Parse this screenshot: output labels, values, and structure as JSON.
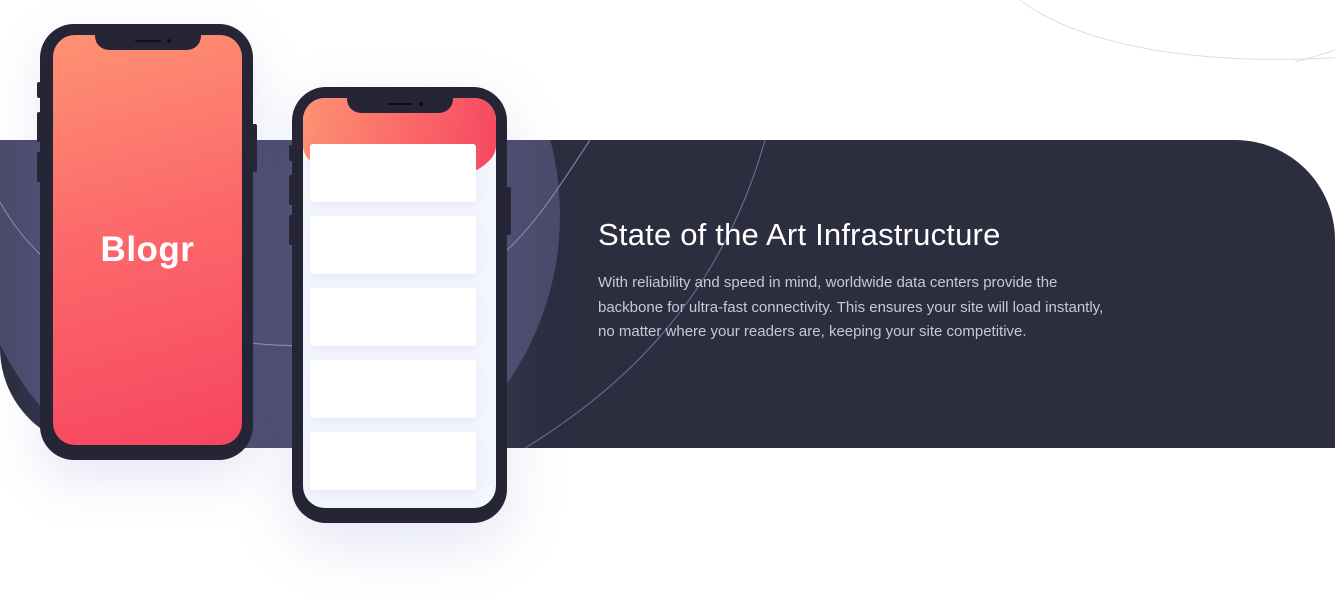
{
  "hero": {
    "heading": "State of the Art Infrastructure",
    "body": "With reliability and speed in mind, worldwide data centers provide the backbone for ultra-fast connectivity. This ensures your site will load instantly, no matter where your readers are, keeping your site competitive."
  },
  "phone_mockup": {
    "logo_text": "Blogr",
    "card_count": 5
  },
  "colors": {
    "band_background": "#2c2d3f",
    "band_circle": "#4a4b6b",
    "gradient_start": "#fe9272",
    "gradient_end": "#f74560",
    "heading": "#ffffff",
    "body_text": "#c8c9d6"
  }
}
